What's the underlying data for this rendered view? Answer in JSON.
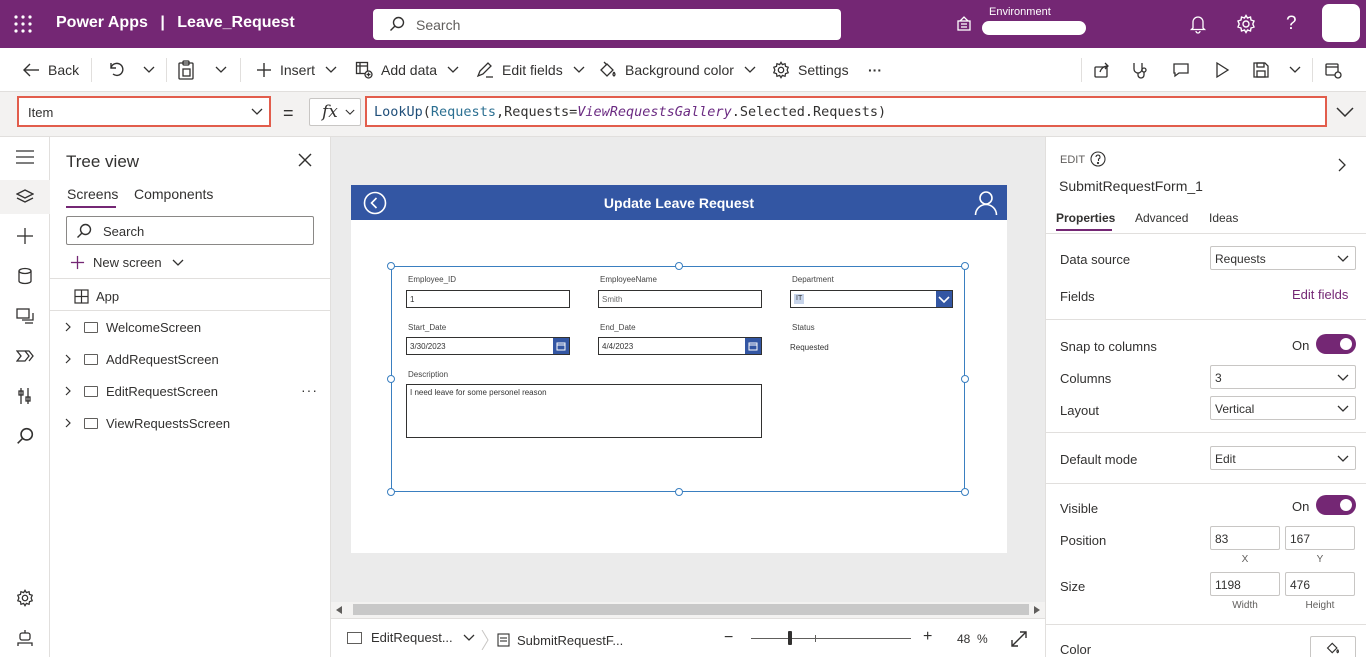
{
  "topbar": {
    "app_name": "Power Apps",
    "divider": "|",
    "doc_name": "Leave_Request",
    "search_placeholder": "Search",
    "environment_label": "Environment"
  },
  "commands": {
    "back": "Back",
    "insert": "Insert",
    "add_data": "Add data",
    "edit_fields": "Edit fields",
    "background_color": "Background color",
    "settings": "Settings",
    "more": "···"
  },
  "formula_bar": {
    "property": "Item",
    "equals": "=",
    "fx": "fx",
    "formula_parts": {
      "fn": "LookUp",
      "open": "(",
      "source": "Requests",
      "comma": ",",
      "field": "Requests",
      "eq": "=",
      "gallery": "ViewRequestsGallery",
      "rest": ".Selected.Requests)"
    }
  },
  "tree": {
    "title": "Tree view",
    "tab_screens": "Screens",
    "tab_components": "Components",
    "search_placeholder": "Search",
    "new_screen": "New screen",
    "app": "App",
    "screens": [
      "WelcomeScreen",
      "AddRequestScreen",
      "EditRequestScreen",
      "ViewRequestsScreen"
    ],
    "more": "···"
  },
  "canvas": {
    "header_title": "Update Leave Request",
    "form": {
      "employee_id_label": "Employee_ID",
      "employee_id_value": "1",
      "employee_name_label": "EmployeeName",
      "employee_name_value": "Smith",
      "department_label": "Department",
      "department_value": "IT",
      "start_date_label": "Start_Date",
      "start_date_value": "3/30/2023",
      "end_date_label": "End_Date",
      "end_date_value": "4/4/2023",
      "status_label": "Status",
      "status_value": "Requested",
      "description_label": "Description",
      "description_value": "I need leave for some personel reason"
    }
  },
  "status_bar": {
    "screen_crumb": "EditRequest...",
    "control_crumb": "SubmitRequestF...",
    "zoom_minus": "−",
    "zoom_plus": "+",
    "zoom_value": "48",
    "zoom_unit": "%"
  },
  "properties": {
    "edit_label": "EDIT",
    "control_name": "SubmitRequestForm_1",
    "tab_properties": "Properties",
    "tab_advanced": "Advanced",
    "tab_ideas": "Ideas",
    "data_source_label": "Data source",
    "data_source_value": "Requests",
    "fields_label": "Fields",
    "edit_fields_link": "Edit fields",
    "snap_label": "Snap to columns",
    "snap_value": "On",
    "columns_label": "Columns",
    "columns_value": "3",
    "layout_label": "Layout",
    "layout_value": "Vertical",
    "default_mode_label": "Default mode",
    "default_mode_value": "Edit",
    "visible_label": "Visible",
    "visible_value": "On",
    "position_label": "Position",
    "position_x": "83",
    "position_y": "167",
    "x_label": "X",
    "y_label": "Y",
    "size_label": "Size",
    "size_width": "1198",
    "size_height": "476",
    "width_label": "Width",
    "height_label": "Height",
    "color_label": "Color"
  },
  "colors": {
    "brand": "#742774",
    "screen_header": "#3356a3",
    "highlight_border": "#e25d4c"
  }
}
